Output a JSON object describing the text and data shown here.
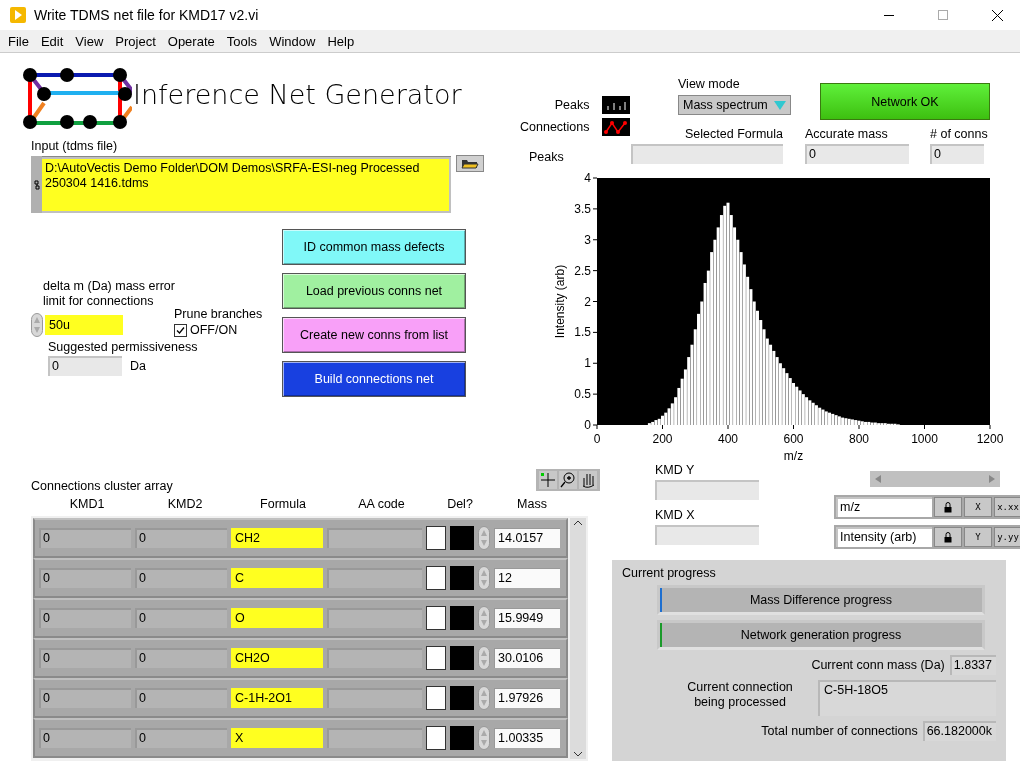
{
  "window": {
    "title": "Write TDMS net file for KMD17 v2.vi"
  },
  "menu": [
    "File",
    "Edit",
    "View",
    "Project",
    "Operate",
    "Tools",
    "Window",
    "Help"
  ],
  "header": {
    "title": "Inference Net Generator"
  },
  "input_file": {
    "label": "Input (tdms file)",
    "value": "D:\\AutoVectis Demo Folder\\DOM Demos\\SRFA-ESI-neg Processed 250304 1416.tdms"
  },
  "buttons": [
    {
      "label": "ID common mass defects",
      "color": "#80f8f8"
    },
    {
      "label": "Load previous conns net",
      "color": "#a0f0a0"
    },
    {
      "label": "Create new conns from list",
      "color": "#f8a0f8"
    },
    {
      "label": "Build connections net",
      "color": "#1840e0"
    }
  ],
  "mass_error": {
    "label": "delta m (Da) mass error limit for connections",
    "value": "50u"
  },
  "prune": {
    "label": "Prune branches",
    "option": "OFF/ON",
    "checked": true
  },
  "permissiveness": {
    "label": "Suggested permissiveness",
    "value": "0",
    "unit": "Da"
  },
  "legend": [
    {
      "label": "Peaks",
      "kind": "sticks"
    },
    {
      "label": "Connections",
      "kind": "network"
    }
  ],
  "view_mode": {
    "label": "View mode",
    "value": "Mass spectrum"
  },
  "status_button": {
    "label": "Network OK",
    "on": true
  },
  "selection": {
    "label": "Peaks",
    "fields": [
      {
        "label": "Selected Formula"
      },
      {
        "label": "Accurate mass",
        "value": "0"
      },
      {
        "label": "# of conns",
        "value": "0"
      }
    ]
  },
  "chart": {
    "chart_data": {
      "type": "bar",
      "xlabel": "m/z",
      "ylabel": "Intensity (arb)",
      "xlim": [
        0,
        1200
      ],
      "ylim": [
        0,
        4
      ],
      "xticks": [
        0,
        200,
        400,
        600,
        800,
        1000,
        1200
      ],
      "yticks": [
        0,
        0.5,
        1,
        1.5,
        2,
        2.5,
        3,
        3.5,
        4
      ],
      "x": [
        160,
        170,
        180,
        190,
        200,
        210,
        220,
        230,
        240,
        250,
        260,
        270,
        280,
        290,
        300,
        310,
        320,
        330,
        340,
        350,
        360,
        370,
        380,
        390,
        400,
        410,
        420,
        430,
        440,
        450,
        460,
        470,
        480,
        490,
        500,
        510,
        520,
        530,
        540,
        550,
        560,
        570,
        580,
        590,
        600,
        610,
        620,
        630,
        640,
        650,
        660,
        670,
        680,
        690,
        700,
        710,
        720,
        730,
        740,
        750,
        760,
        770,
        780,
        790,
        800,
        810,
        820,
        830,
        840,
        850,
        860,
        870,
        880,
        890,
        900,
        910,
        920
      ],
      "series": [
        {
          "color": "#ffffff",
          "values": [
            0.03,
            0.05,
            0.08,
            0.1,
            0.15,
            0.2,
            0.27,
            0.35,
            0.45,
            0.6,
            0.75,
            0.9,
            1.1,
            1.3,
            1.55,
            1.8,
            2.0,
            2.3,
            2.5,
            2.8,
            3.0,
            3.2,
            3.4,
            3.55,
            3.6,
            3.4,
            3.2,
            3.0,
            2.8,
            2.6,
            2.4,
            2.2,
            2.0,
            1.85,
            1.7,
            1.55,
            1.4,
            1.3,
            1.2,
            1.1,
            1.0,
            0.92,
            0.84,
            0.76,
            0.68,
            0.62,
            0.56,
            0.5,
            0.45,
            0.4,
            0.36,
            0.32,
            0.28,
            0.25,
            0.22,
            0.2,
            0.18,
            0.16,
            0.14,
            0.12,
            0.11,
            0.1,
            0.09,
            0.08,
            0.07,
            0.06,
            0.05,
            0.05,
            0.04,
            0.04,
            0.03,
            0.03,
            0.03,
            0.02,
            0.02,
            0.02,
            0.01
          ]
        }
      ]
    }
  },
  "kmd": [
    {
      "label": "KMD Y"
    },
    {
      "label": "KMD X"
    }
  ],
  "axes": [
    {
      "name": "m/z",
      "axis": "X",
      "format": "x.xx"
    },
    {
      "name": "Intensity (arb)",
      "axis": "Y",
      "format": "y.yy"
    }
  ],
  "array": {
    "label": "Connections cluster array",
    "columns": [
      "KMD1",
      "KMD2",
      "Formula",
      "AA code",
      "Del?",
      "Mass"
    ],
    "rows": [
      {
        "kmd1": "0",
        "kmd2": "0",
        "formula": "CH2",
        "mass": "14.0157",
        "delete": false
      },
      {
        "kmd1": "0",
        "kmd2": "0",
        "formula": "C",
        "mass": "12",
        "delete": false
      },
      {
        "kmd1": "0",
        "kmd2": "0",
        "formula": "O",
        "mass": "15.9949",
        "delete": false
      },
      {
        "kmd1": "0",
        "kmd2": "0",
        "formula": "CH2O",
        "mass": "30.0106",
        "delete": false
      },
      {
        "kmd1": "0",
        "kmd2": "0",
        "formula": "C-1H-2O1",
        "mass": "1.97926",
        "delete": false
      },
      {
        "kmd1": "0",
        "kmd2": "0",
        "formula": "X",
        "mass": "1.00335",
        "delete": false
      }
    ]
  },
  "progress": {
    "title": "Current progress",
    "bars": [
      {
        "label": "Mass Difference progress",
        "level": 0.005,
        "color": "#1e6fd0"
      },
      {
        "label": "Network generation progress",
        "level": 0.005,
        "color": "#1a9a2a"
      }
    ],
    "conn_mass": {
      "label": "Current conn mass (Da)",
      "value": "1.8337"
    },
    "current": {
      "label": "Current connection being processed",
      "value": "C-5H-18O5"
    },
    "total": {
      "label": "Total number of connections",
      "value": "66.182000k"
    }
  }
}
